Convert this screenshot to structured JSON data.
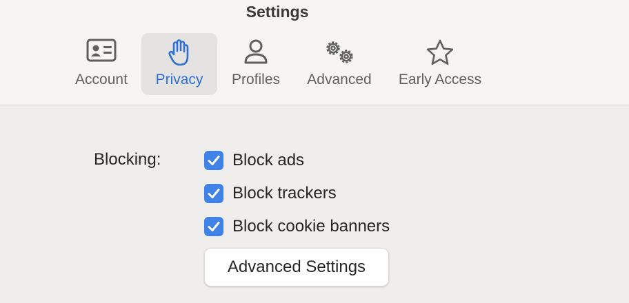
{
  "window": {
    "title": "Settings"
  },
  "tabs": [
    {
      "label": "Account",
      "icon": "id-card-icon",
      "active": false
    },
    {
      "label": "Privacy",
      "icon": "hand-icon",
      "active": true
    },
    {
      "label": "Profiles",
      "icon": "person-icon",
      "active": false
    },
    {
      "label": "Advanced",
      "icon": "gears-icon",
      "active": false
    },
    {
      "label": "Early Access",
      "icon": "star-icon",
      "active": false
    }
  ],
  "privacy": {
    "blocking_label": "Blocking:",
    "options": [
      {
        "label": "Block ads",
        "checked": true
      },
      {
        "label": "Block trackers",
        "checked": true
      },
      {
        "label": "Block cookie banners",
        "checked": true
      }
    ],
    "advanced_button_label": "Advanced Settings"
  },
  "colors": {
    "accent": "#3f82e8",
    "active_tab_text": "#2f6fd0",
    "toolbar_bg": "#f6f5f3",
    "content_bg": "#f0eeec"
  }
}
